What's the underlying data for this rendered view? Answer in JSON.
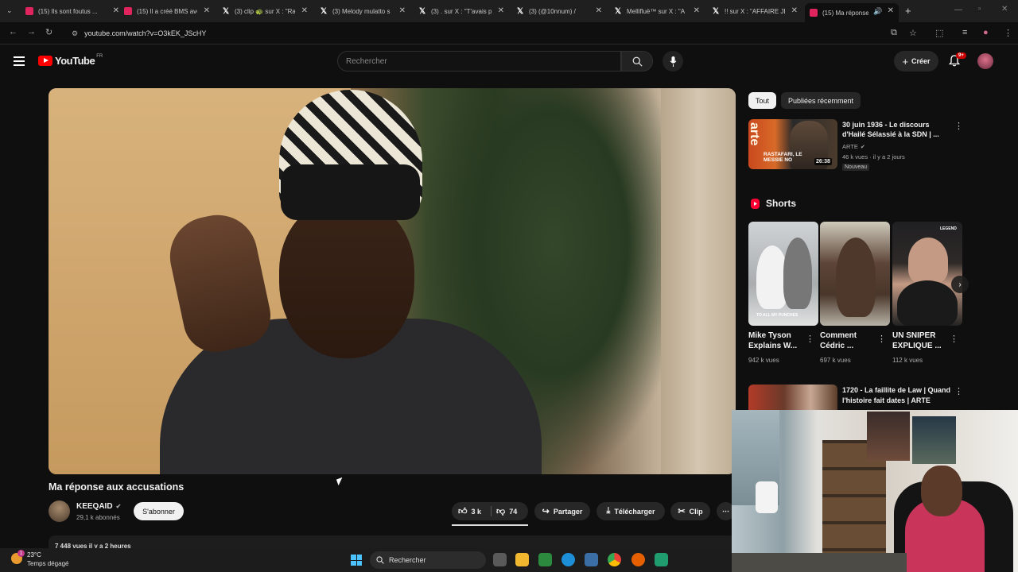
{
  "browser": {
    "tabs": [
      {
        "label": "(15) Ils sont foutus ...",
        "icon": "youtube-icon"
      },
      {
        "label": "(15) Il a créé BMS ave",
        "icon": "youtube-icon"
      },
      {
        "label": "(3) clip 🐢 sur X : \"Ra",
        "icon": "x-icon"
      },
      {
        "label": "(3) Melody mulatto s",
        "icon": "x-icon"
      },
      {
        "label": "(3) . sur X : \"T'avais p",
        "icon": "x-icon"
      },
      {
        "label": "(3) (@10nnum) /",
        "icon": "x-icon"
      },
      {
        "label": "Mellifluë™ sur X : \"A",
        "icon": "x-icon"
      },
      {
        "label": "!! sur X : \"AFFAIRE JE",
        "icon": "x-icon"
      },
      {
        "label": "(15) Ma réponse",
        "icon": "youtube-icon",
        "active": true
      }
    ],
    "url": "youtube.com/watch?v=O3kEK_JScHY"
  },
  "header": {
    "logo": "YouTube",
    "country": "FR",
    "search_placeholder": "Rechercher",
    "create_label": "Créer",
    "notifications": "9+"
  },
  "video": {
    "title": "Ma réponse aux accusations",
    "channel": "KEEQAID",
    "subscribers": "29,1 k abonnés",
    "subscribe_label": "S'abonner",
    "likes": "3 k",
    "dislikes": "74",
    "share_label": "Partager",
    "download_label": "Télécharger",
    "clip_label": "Clip",
    "views": "7 448 vues  il y a 2 heures"
  },
  "sidebar": {
    "chips": [
      "Tout",
      "Publiées récemment"
    ],
    "rec1": {
      "title": "30 juin 1936 - Le discours d'Hailé Sélassié à la SDN | ...",
      "channel": "ARTE",
      "meta": "46 k vues · il y a 2 jours",
      "badge": "Nouveau",
      "duration": "26:38",
      "thumb_brand": "arte",
      "thumb_caption": "RASTAFARI, LE MESSIE NO"
    },
    "shorts_label": "Shorts",
    "shorts": [
      {
        "title": "Mike Tyson Explains W...",
        "views": "942 k vues",
        "overlay": "TO ALL MY PUNCHES"
      },
      {
        "title": "Comment Cédric ...",
        "views": "697 k vues",
        "overlay": ""
      },
      {
        "title": "UN SNIPER EXPLIQUE ...",
        "views": "112 k vues",
        "overlay": "LEGEND"
      }
    ],
    "rec2": {
      "title": "1720 - La faillite de Law | Quand l'histoire fait dates | ARTE"
    }
  },
  "taskbar": {
    "temperature": "23°C",
    "condition": "Temps dégagé",
    "weather_badge": "1",
    "search_label": "Rechercher"
  }
}
